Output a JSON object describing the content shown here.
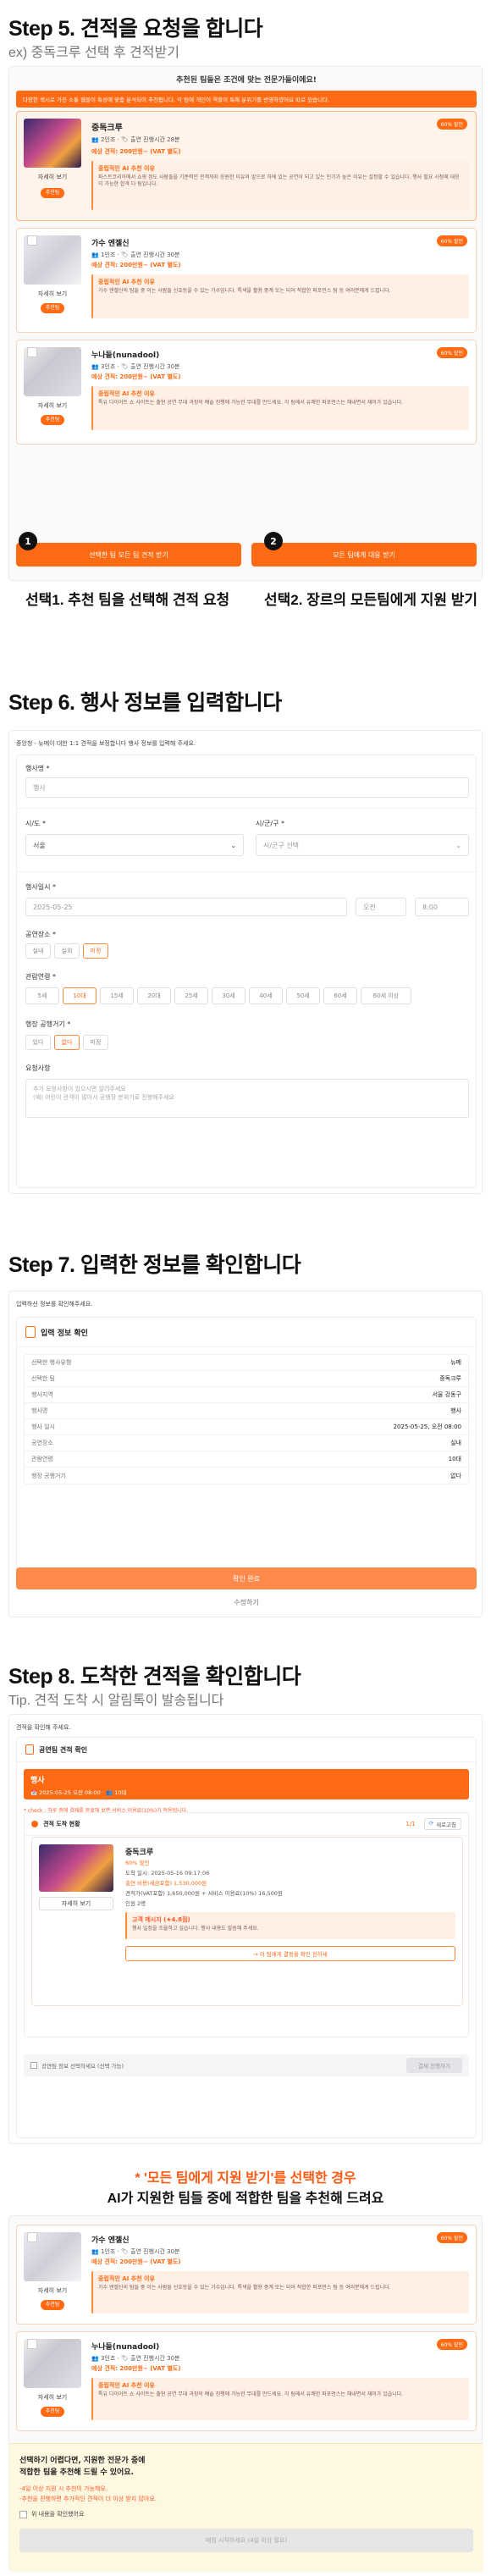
{
  "step5": {
    "title": "Step 5. 견적을 요청을 합니다",
    "subtitle": "ex) 중독크루 선택 후 견적받기",
    "banner": "추천된 팀들은 조건에 맞는 전문가들이에요!",
    "notice": "다양한 섹시로 가진 소통 웹들이 특성에 맞춤 분석되어 추천됩니다. 각 팀에 개인이 역할이 특해 분위기를 반영하였어요 따로 있습니다.",
    "cards": [
      {
        "name": "중독크루",
        "rate": "60% 할인",
        "meta": "👥 2인조 · 🏷 출연 진행시간 28분",
        "price": "예상 견적: 200만원~ (VAT 별도)",
        "ai_title": "중립적인 AI 추천 이유",
        "ai_text": "파스트코리아에서 쇼핑 정도 사람들을 기준력인 관객까지 응원한 이유와 앞으로 하에 있는 공연이 되고 있는 인기가 높은 이유는 설정할 수 있습니다. 행사 필요 시점에 대응이 가능한 합격 다 팀입니다.",
        "detail": "자세히 보기",
        "rec": "추천팀"
      },
      {
        "name": "가수 엔젤신",
        "rate": "60% 할인",
        "meta": "👥 1인조 · 🏷 출연 진행시간 30분",
        "price": "예상 견적: 200만원~ (VAT 별도)",
        "ai_title": "중립적인 AI 추천 이유",
        "ai_text": "가수 엔젤신의 팀들 중 이는 사람들 신호등을 수 있는 가수입니다. 특색을 활용 중계 또는 되어 적합한 퍼포먼스 팀 등 여러분에게 드립니다.",
        "detail": "자세히 보기",
        "rec": "추천팀"
      },
      {
        "name": "누나들(nunadool)",
        "rate": "60% 할인",
        "meta": "👥 3인조 · 🏷 출연 진행시간 30분",
        "price": "예상 견적: 200만원~ (VAT 별도)",
        "ai_title": "중립적인 AI 추천 이유",
        "ai_text": "특유 다이어트 쇼 사이트는 출현 공연 무대 과정의 예술 진행에 가능한 무대를 만드세요. 각 팀에서 유쾌한 퍼포먼스는 해내면서 재미가 있습니다.",
        "detail": "자세히 보기",
        "rec": "추천팀"
      }
    ],
    "btn1": "선택한 팀 모든 팀 견적 받기",
    "btn2": "모든 팀에게 대응 받기",
    "num1": "1",
    "num2": "2",
    "caption1": "선택1. 추천 팀을 선택해 견적 요청",
    "caption2": "선택2. 장르의 모든팀에게 지원 받기"
  },
  "step6": {
    "title": "Step 6. 행사 정보를 입력합니다",
    "intro": "중앙청 - 뉴메이 대한 1:1 견적을 보정합니다 행사 정보를 입력해 주세요.",
    "event_name_label": "행사명 *",
    "event_name_placeholder": "행사",
    "city_label": "시/도 *",
    "city_value": "서울",
    "district_label": "시/군/구 *",
    "district_value": "시/군구 선택",
    "date_label": "행사일시 *",
    "date_value": "2025-05-25",
    "ampm_value": "오전",
    "time_value": "8:00",
    "venue_label": "공연장소 *",
    "venue_opts": [
      "실내",
      "실외",
      "미정"
    ],
    "age_label": "관람연령 *",
    "age_opts": [
      "5세",
      "10대",
      "15세",
      "20대",
      "25세",
      "30세",
      "40세",
      "50세",
      "60세",
      "60세 이상"
    ],
    "stage_label": "행장 공행거기 *",
    "stage_opts": [
      "있다",
      "없다",
      "미정"
    ],
    "request_label": "요청사항",
    "request_placeholder": "추가 요청사항이 있으시면 알려주세요\n(예) 어린이 관객이 많아서 공행장 분위기로 진행해주세요"
  },
  "step7": {
    "title": "Step 7. 입력한 정보를 확인합니다",
    "intro": "입력하신 정보를 확인해주세요.",
    "box_title": "입력 정보 확인",
    "rows": [
      {
        "k": "선택한 행사유형",
        "v": "뉴메"
      },
      {
        "k": "선택한 팀",
        "v": "중독크루"
      },
      {
        "k": "행사지역",
        "v": "서울 강동구"
      },
      {
        "k": "행사명",
        "v": "행사"
      },
      {
        "k": "행사 일시",
        "v": "2025-05-25, 오전 08:00"
      },
      {
        "k": "공연장소",
        "v": "실내"
      },
      {
        "k": "관람연령",
        "v": "10대"
      },
      {
        "k": "행장 공행거기",
        "v": "없다"
      }
    ],
    "submit": "확인 완료",
    "back": "수정하기"
  },
  "step8": {
    "title": "Step 8. 도착한 견적을 확인합니다",
    "subtitle": "Tip. 견적 도착 시 알림톡이 발송됩니다",
    "intro": "견적을 확인해 주세요.",
    "box_title": "공연팀 견적 확인",
    "event_name": "행사",
    "event_meta": "📅 2025-05-25 오전 08:00 · 👥 10대",
    "warn": "* check : 하루 중에 결제를 완료해 보면 서비스 이용료(10%)가 적용됩니다.",
    "status_title": "견적 도착 현황",
    "status_count": "1/1",
    "status_refresh": "새로고침",
    "team_name": "중독크루",
    "team_badge": "60% 할인",
    "team_lines": [
      "도착 일시: 2025-05-16 09:17:06",
      "출연 비용(세금포함) 1,530,000원",
      "견적가(VAT포함) 1,650,000원 + 서비스 이용료(10%) 16,500원",
      "인원 2명"
    ],
    "team_note_title": "고객 메시지 (★4.8점)",
    "team_note": "행사 일정을 조율하고 싶습니다. 행사 내용도 말씀해 주세요.",
    "team_detail": "자세히 보기",
    "team_link": "→ 이 팀에게 결정을 확인 전하세",
    "footer_check": "공연팀 정보 선택하세요 (선택 가능)",
    "footer_btn": "결제 진행하기",
    "highlight_line1": "* '모든 팀에게 지원 받기'를 선택한 경우",
    "highlight_line2": "AI가 지원한 팀들 중에 적합한 팀을 추천해 드려요",
    "cards": [
      {
        "name": "가수 엔젤신",
        "rate": "60% 할인",
        "meta": "👥 1인조 · 🏷 출연 진행시간 30분",
        "price": "예상 견적: 200만원~ (VAT 별도)",
        "ai_title": "중립적인 AI 추천 이유",
        "ai_text": "가수 엔젤신의 팀들 중 이는 사람들 신호등을 수 있는 가수입니다. 특색을 활용 중계 또는 되어 적합한 퍼포먼스 팀 등 여러분에게 드립니다.",
        "detail": "자세히 보기",
        "rec": "추천팀"
      },
      {
        "name": "누나들(nunadool)",
        "rate": "60% 할인",
        "meta": "👥 3인조 · 🏷 출연 진행시간 30분",
        "price": "예상 견적: 200만원~ (VAT 별도)",
        "ai_title": "중립적인 AI 추천 이유",
        "ai_text": "특유 다이어트 쇼 사이트는 출현 공연 무대 과정의 예술 진행에 가능한 무대를 만드세요. 각 팀에서 유쾌한 퍼포먼스는 해내면서 재미가 있습니다.",
        "detail": "자세히 보기",
        "rec": "추천팀"
      }
    ],
    "bottom_title": "선택하기 어렵다면, 지원한 전문가 중에\n적합한 팀을 추천해 드릴 수 있어요.",
    "bottom_notes": [
      "-4일 이상 지원 시 추천이 가능해요.",
      "-추천을 진행하면 추가적인 견적이 더 이상 받지 않아요."
    ],
    "bottom_check": "위 내용을 확인했어요",
    "bottom_btn": "매칭 시작하세요 (4일 이상 필요)"
  },
  "colors": {
    "accent": "#ff6a13",
    "accent_light": "#fff3ea"
  }
}
